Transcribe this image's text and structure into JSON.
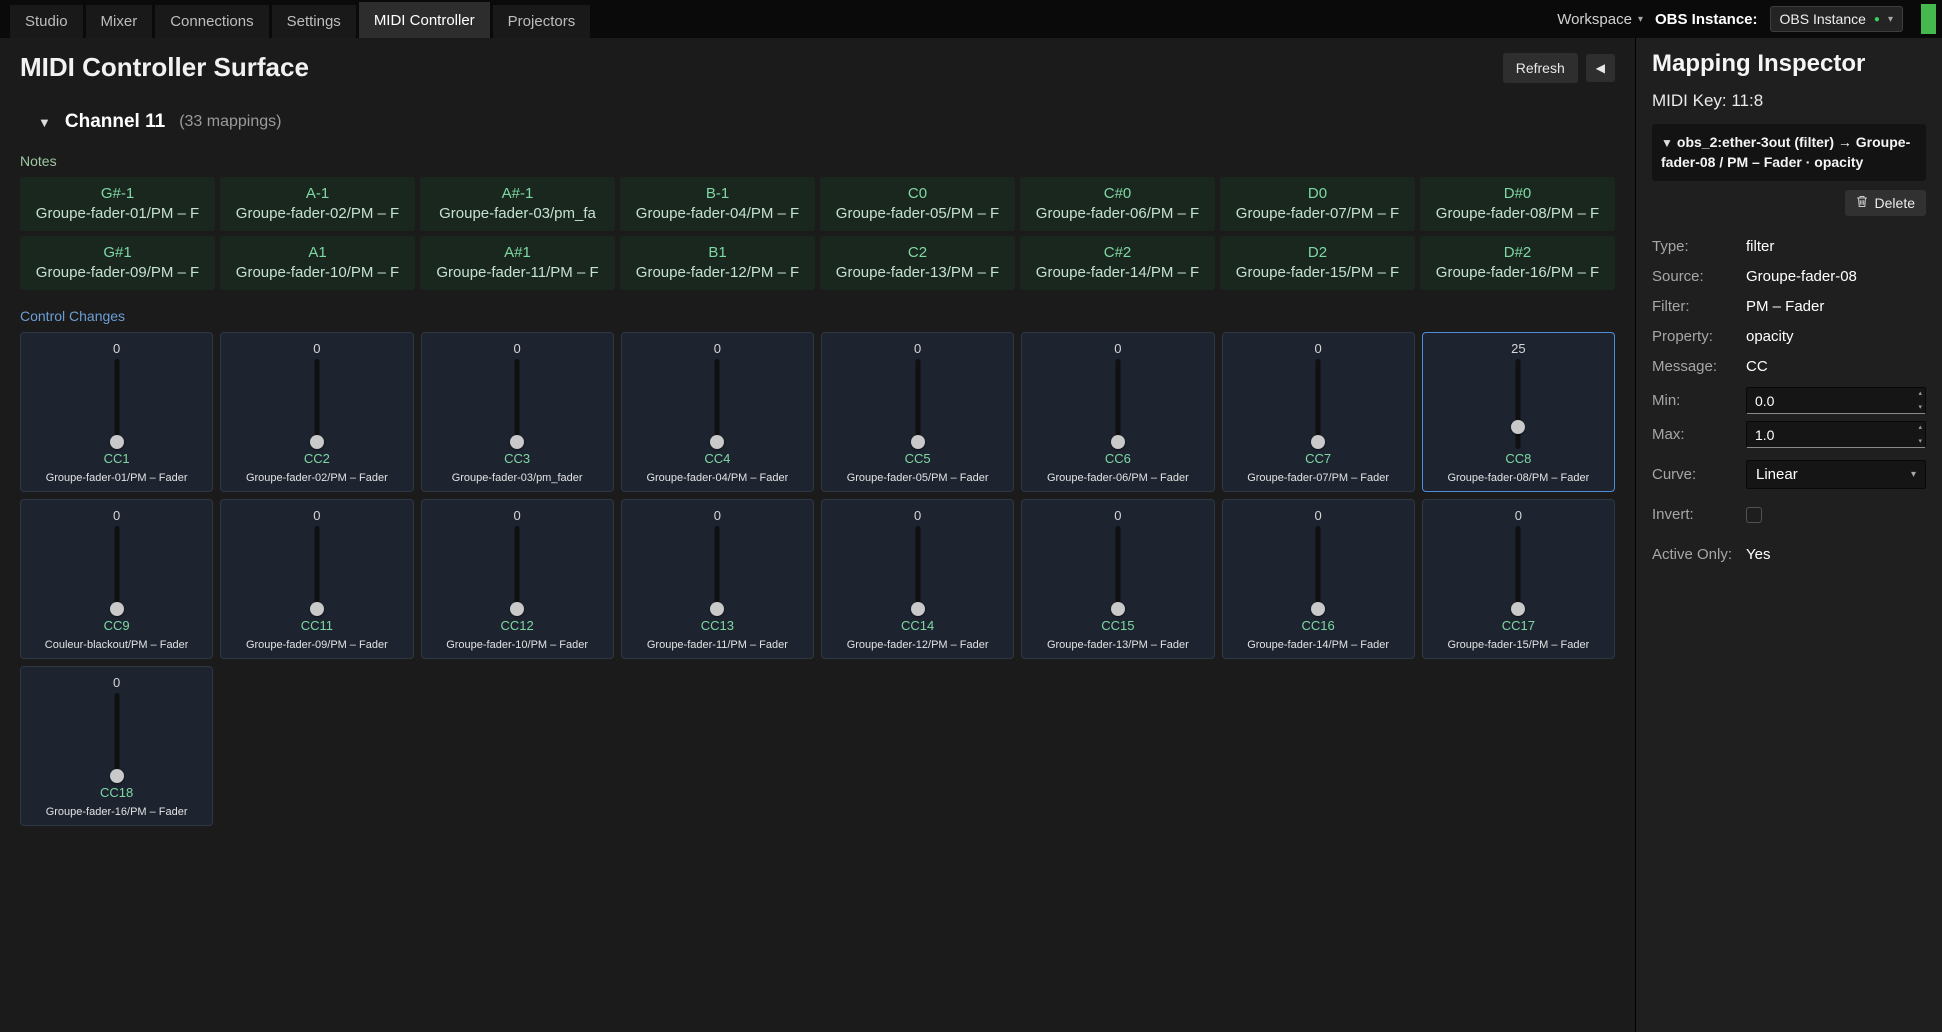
{
  "icons": {
    "triangle_down": "▼",
    "chevron_down": "▾",
    "collapse_left": "◀",
    "dot": "●",
    "spin_up": "▴",
    "spin_down": "▾"
  },
  "topbar": {
    "tabs": [
      {
        "label": "Studio",
        "active": false
      },
      {
        "label": "Mixer",
        "active": false
      },
      {
        "label": "Connections",
        "active": false
      },
      {
        "label": "Settings",
        "active": false
      },
      {
        "label": "MIDI Controller",
        "active": true
      },
      {
        "label": "Projectors",
        "active": false
      }
    ],
    "workspace_label": "Workspace",
    "obs_instance_label": "OBS Instance:",
    "obs_instance_value": "OBS Instance"
  },
  "surface": {
    "title": "MIDI Controller Surface",
    "refresh_label": "Refresh",
    "channel_name": "Channel 11",
    "channel_count": "(33 mappings)",
    "notes_label": "Notes",
    "cc_label": "Control Changes",
    "notes": [
      {
        "note": "G#-1",
        "target": "Groupe-fader-01/PM – F"
      },
      {
        "note": "A-1",
        "target": "Groupe-fader-02/PM – F"
      },
      {
        "note": "A#-1",
        "target": "Groupe-fader-03/pm_fa"
      },
      {
        "note": "B-1",
        "target": "Groupe-fader-04/PM – F"
      },
      {
        "note": "C0",
        "target": "Groupe-fader-05/PM – F"
      },
      {
        "note": "C#0",
        "target": "Groupe-fader-06/PM – F"
      },
      {
        "note": "D0",
        "target": "Groupe-fader-07/PM – F"
      },
      {
        "note": "D#0",
        "target": "Groupe-fader-08/PM – F"
      },
      {
        "note": "G#1",
        "target": "Groupe-fader-09/PM – F"
      },
      {
        "note": "A1",
        "target": "Groupe-fader-10/PM – F"
      },
      {
        "note": "A#1",
        "target": "Groupe-fader-11/PM – F"
      },
      {
        "note": "B1",
        "target": "Groupe-fader-12/PM – F"
      },
      {
        "note": "C2",
        "target": "Groupe-fader-13/PM – F"
      },
      {
        "note": "C#2",
        "target": "Groupe-fader-14/PM – F"
      },
      {
        "note": "D2",
        "target": "Groupe-fader-15/PM – F"
      },
      {
        "note": "D#2",
        "target": "Groupe-fader-16/PM – F"
      }
    ],
    "ccs": [
      {
        "cc": "CC1",
        "value": 0,
        "target": "Groupe-fader-01/PM – Fader",
        "selected": false
      },
      {
        "cc": "CC2",
        "value": 0,
        "target": "Groupe-fader-02/PM – Fader",
        "selected": false
      },
      {
        "cc": "CC3",
        "value": 0,
        "target": "Groupe-fader-03/pm_fader",
        "selected": false
      },
      {
        "cc": "CC4",
        "value": 0,
        "target": "Groupe-fader-04/PM – Fader",
        "selected": false
      },
      {
        "cc": "CC5",
        "value": 0,
        "target": "Groupe-fader-05/PM – Fader",
        "selected": false
      },
      {
        "cc": "CC6",
        "value": 0,
        "target": "Groupe-fader-06/PM – Fader",
        "selected": false
      },
      {
        "cc": "CC7",
        "value": 0,
        "target": "Groupe-fader-07/PM – Fader",
        "selected": false
      },
      {
        "cc": "CC8",
        "value": 25,
        "target": "Groupe-fader-08/PM – Fader",
        "selected": true
      },
      {
        "cc": "CC9",
        "value": 0,
        "target": "Couleur-blackout/PM – Fader",
        "selected": false
      },
      {
        "cc": "CC11",
        "value": 0,
        "target": "Groupe-fader-09/PM – Fader",
        "selected": false
      },
      {
        "cc": "CC12",
        "value": 0,
        "target": "Groupe-fader-10/PM – Fader",
        "selected": false
      },
      {
        "cc": "CC13",
        "value": 0,
        "target": "Groupe-fader-11/PM – Fader",
        "selected": false
      },
      {
        "cc": "CC14",
        "value": 0,
        "target": "Groupe-fader-12/PM – Fader",
        "selected": false
      },
      {
        "cc": "CC15",
        "value": 0,
        "target": "Groupe-fader-13/PM – Fader",
        "selected": false
      },
      {
        "cc": "CC16",
        "value": 0,
        "target": "Groupe-fader-14/PM – Fader",
        "selected": false
      },
      {
        "cc": "CC17",
        "value": 0,
        "target": "Groupe-fader-15/PM – Fader",
        "selected": false
      },
      {
        "cc": "CC18",
        "value": 0,
        "target": "Groupe-fader-16/PM – Fader",
        "selected": false
      }
    ]
  },
  "inspector": {
    "title": "Mapping Inspector",
    "midi_key": "MIDI Key: 11:8",
    "mapping_header": "obs_2:ether-3out (filter) → Groupe-fader-08 / PM – Fader · opacity",
    "delete_label": "Delete",
    "type_label": "Type:",
    "type_value": "filter",
    "source_label": "Source:",
    "source_value": "Groupe-fader-08",
    "filter_label": "Filter:",
    "filter_value": "PM – Fader",
    "property_label": "Property:",
    "property_value": "opacity",
    "message_label": "Message:",
    "message_value": "CC",
    "min_label": "Min:",
    "min_value": "0.0",
    "max_label": "Max:",
    "max_value": "1.0",
    "curve_label": "Curve:",
    "curve_value": "Linear",
    "invert_label": "Invert:",
    "invert_checked": false,
    "active_only_label": "Active Only:",
    "active_only_value": "Yes"
  },
  "colors": {
    "accent_green": "#7fd8a4",
    "accent_blue": "#4e8ed8",
    "status_green": "#45b94d"
  }
}
